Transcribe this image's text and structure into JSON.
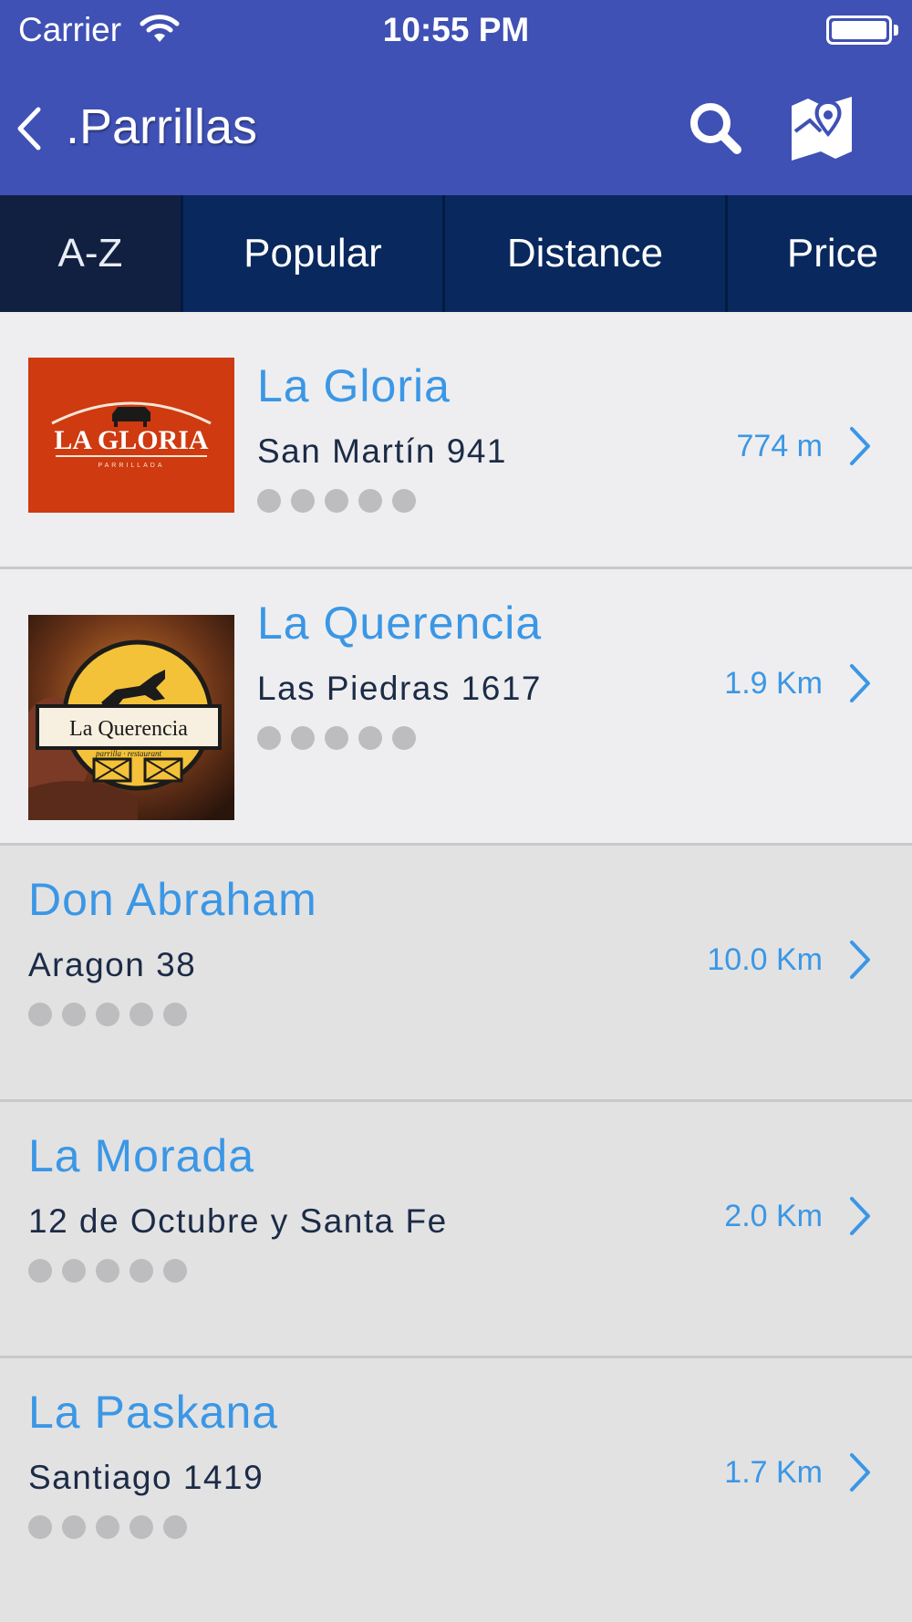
{
  "status_bar": {
    "carrier": "Carrier",
    "time": "10:55 PM"
  },
  "nav": {
    "title": ".Parrillas",
    "back_icon": "chevron-left-icon",
    "search_icon": "search-icon",
    "map_icon": "map-pin-icon"
  },
  "tabs": [
    {
      "label": "A-Z",
      "active": true
    },
    {
      "label": "Popular",
      "active": false
    },
    {
      "label": "Distance",
      "active": false
    },
    {
      "label": "Price",
      "active": false
    }
  ],
  "restaurants": [
    {
      "name": "La Gloria",
      "address": "San Martín 941",
      "distance": "774 m",
      "rating": 0,
      "logo_text": "LA GLORIA",
      "logo_subtext": "PARRILLADA"
    },
    {
      "name": "La Querencia",
      "address": "Las Piedras 1617",
      "distance": "1.9 Km",
      "rating": 0,
      "logo_text": "La Querencia",
      "logo_subtext": "parrilla · restaurant"
    },
    {
      "name": "Don Abraham",
      "address": "Aragon 38",
      "distance": "10.0 Km",
      "rating": 0
    },
    {
      "name": "La Morada",
      "address": "12 de Octubre y Santa Fe",
      "distance": "2.0 Km",
      "rating": 0
    },
    {
      "name": "La Paskana",
      "address": "Santiago 1419",
      "distance": "1.7 Km",
      "rating": 0
    }
  ],
  "colors": {
    "nav_bg": "#3f51b5",
    "tab_bg": "#08285e",
    "tab_active_bg": "#112040",
    "accent": "#3b97e5"
  }
}
